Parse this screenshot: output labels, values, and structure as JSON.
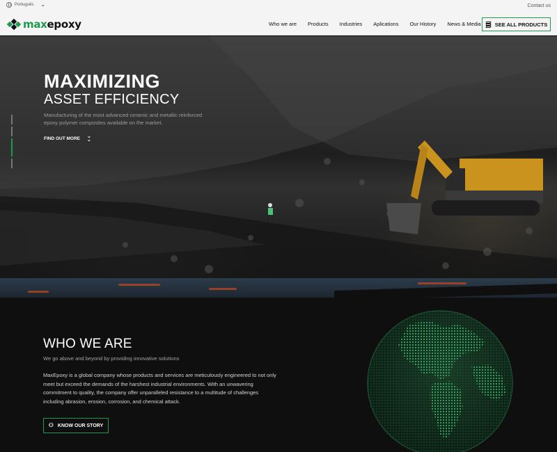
{
  "topbar": {
    "language": "Português",
    "contact": "Contact us"
  },
  "brand": {
    "logo_text_prefix": "max",
    "logo_text_suffix": "epoxy",
    "accent_color": "#1f9a4f"
  },
  "nav": {
    "items": [
      "Who we are",
      "Products",
      "Industries",
      "Aplications",
      "Our History",
      "News & Media"
    ],
    "cta_label": "SEE ALL PRODUCTS"
  },
  "hero": {
    "title_line1": "MAXIMIZING",
    "title_line2": "ASSET EFFICIENCY",
    "description": "Manufacturing of the most advanced ceramic and metallic reinforced epoxy polymer composites available on the market.",
    "cta_label": "FIND OUT MORE",
    "slides_count": 4,
    "active_slide": 3
  },
  "who_we_are": {
    "title": "WHO WE ARE",
    "subtitle": "We go above and beyond by providing innovative solutions",
    "body": "MaxEpoxy is a global company whose products and services are meticulously engineered to not only meet but exceed the demands of the harshest industrial environments. With an unwavering commitment to quality, the company offer unparalleled resistance to a multitude of challenges including abrasion, erosion, corrosion, and chemical attack.",
    "cta_label": "KNOW OUR STORY"
  },
  "icons": [
    "globe-icon",
    "chevron-down-icon",
    "layers-icon",
    "double-chevron-down-icon",
    "people-icon"
  ]
}
